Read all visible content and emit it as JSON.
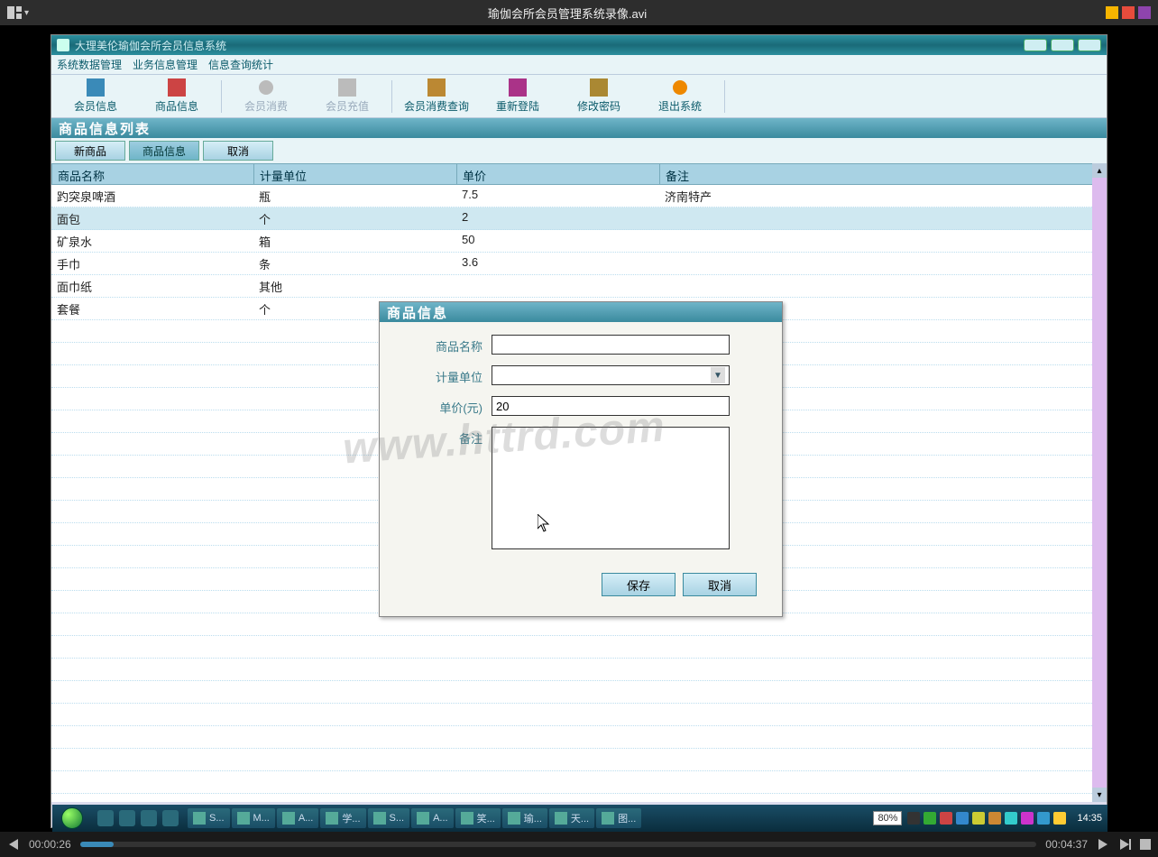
{
  "player": {
    "title": "瑜伽会所会员管理系统录像.avi",
    "elapsed": "00:00:26",
    "duration": "00:04:37"
  },
  "app": {
    "title": "大理美伦瑜伽会所会员信息系统",
    "menubar": [
      "系统数据管理",
      "业务信息管理",
      "信息查询统计"
    ],
    "toolbar": [
      {
        "label": "会员信息",
        "disabled": false
      },
      {
        "label": "商品信息",
        "disabled": false
      },
      {
        "label": "会员消费",
        "disabled": true
      },
      {
        "label": "会员充值",
        "disabled": true
      },
      {
        "label": "会员消费查询",
        "disabled": false
      },
      {
        "label": "重新登陆",
        "disabled": false
      },
      {
        "label": "修改密码",
        "disabled": false
      },
      {
        "label": "退出系统",
        "disabled": false
      }
    ],
    "list_title": "商品信息列表",
    "tabs": {
      "new": "新商品",
      "info": "商品信息",
      "cancel": "取消"
    },
    "columns": {
      "name": "商品名称",
      "unit": "计量单位",
      "price": "单价",
      "note": "备注"
    },
    "rows": [
      {
        "name": "趵突泉啤酒",
        "unit": "瓶",
        "price": "7.5",
        "note": "济南特产"
      },
      {
        "name": "面包",
        "unit": "个",
        "price": "2",
        "note": ""
      },
      {
        "name": "矿泉水",
        "unit": "箱",
        "price": "50",
        "note": ""
      },
      {
        "name": "手巾",
        "unit": "条",
        "price": "3.6",
        "note": ""
      },
      {
        "name": "面巾纸",
        "unit": "其他",
        "price": "",
        "note": ""
      },
      {
        "name": "套餐",
        "unit": "个",
        "price": "",
        "note": ""
      }
    ],
    "selected_row": 1
  },
  "dialog": {
    "title": "商品信息",
    "labels": {
      "name": "商品名称",
      "unit": "计量单位",
      "price": "单价(元)",
      "note": "备注"
    },
    "values": {
      "name": "",
      "unit": "",
      "price": "20",
      "note": ""
    },
    "buttons": {
      "save": "保存",
      "cancel": "取消"
    }
  },
  "taskbar": {
    "zoom": "80%",
    "clock": "14:35",
    "tasks": [
      "S...",
      "M...",
      "A...",
      "学...",
      "S...",
      "A...",
      "笑...",
      "瑜...",
      "天...",
      "图..."
    ]
  },
  "watermark": "www.httrd.com"
}
